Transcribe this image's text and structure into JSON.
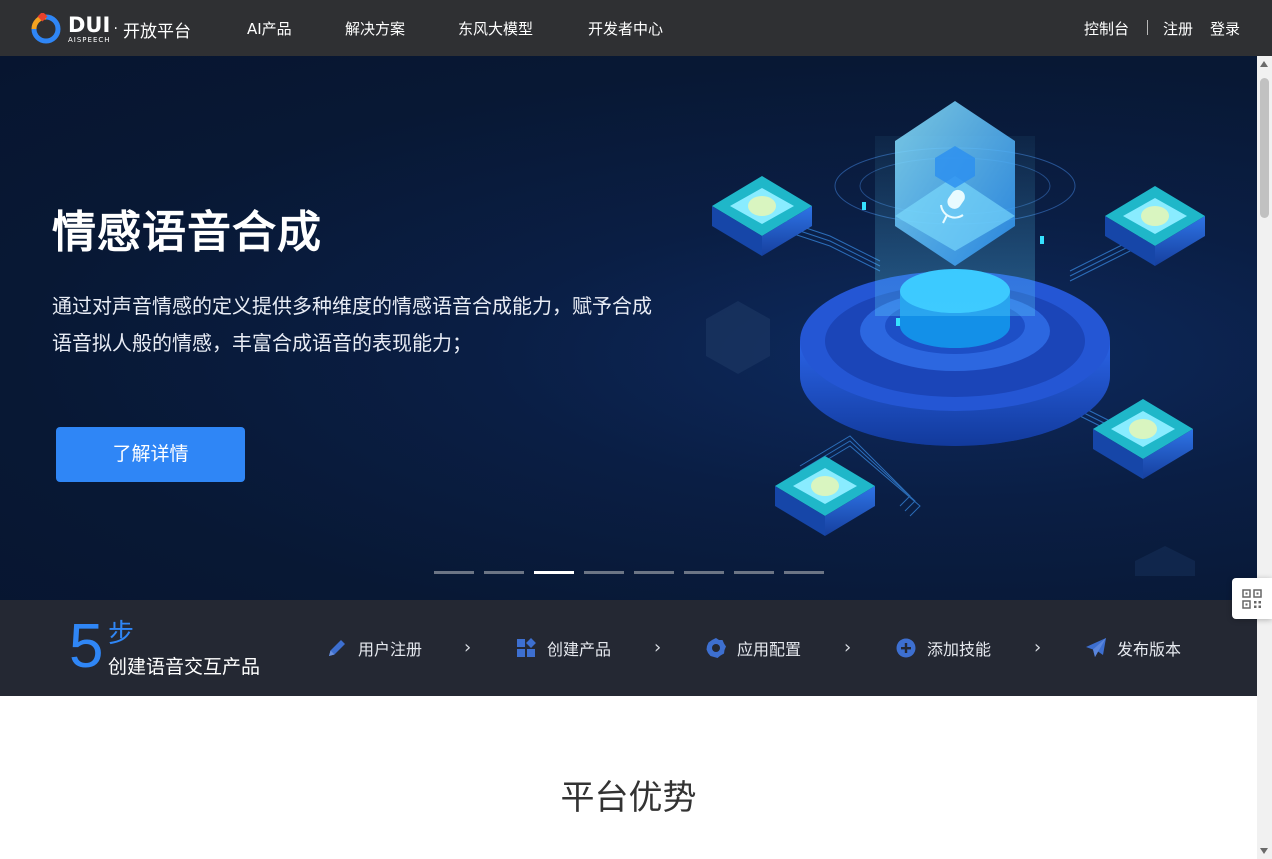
{
  "brand": {
    "logo_text": "DUI",
    "logo_sub": "AISPEECH",
    "separator": "·",
    "platform_name": "开放平台"
  },
  "nav": {
    "items": [
      {
        "label": "AI产品"
      },
      {
        "label": "解决方案"
      },
      {
        "label": "东风大模型"
      },
      {
        "label": "开发者中心"
      }
    ],
    "console": "控制台",
    "register": "注册",
    "login": "登录"
  },
  "hero": {
    "title": "情感语音合成",
    "description": "通过对声音情感的定义提供多种维度的情感语音合成能力，赋予合成语音拟人般的情感，丰富合成语音的表现能力；",
    "button": "了解详情",
    "carousel": {
      "total": 8,
      "active_index": 2
    }
  },
  "steps": {
    "count": "5",
    "unit": "步",
    "caption": "创建语音交互产品",
    "items": [
      {
        "label": "用户注册",
        "icon": "pencil-icon"
      },
      {
        "label": "创建产品",
        "icon": "grid-icon"
      },
      {
        "label": "应用配置",
        "icon": "gear-icon"
      },
      {
        "label": "添加技能",
        "icon": "plus-circle-icon"
      },
      {
        "label": "发布版本",
        "icon": "paper-plane-icon"
      }
    ],
    "chevron": "›"
  },
  "section": {
    "title": "平台优势"
  },
  "colors": {
    "nav_bg": "#2f3033",
    "hero_bg": "#081834",
    "accent": "#2f86f6",
    "steps_bg": "#242833"
  }
}
